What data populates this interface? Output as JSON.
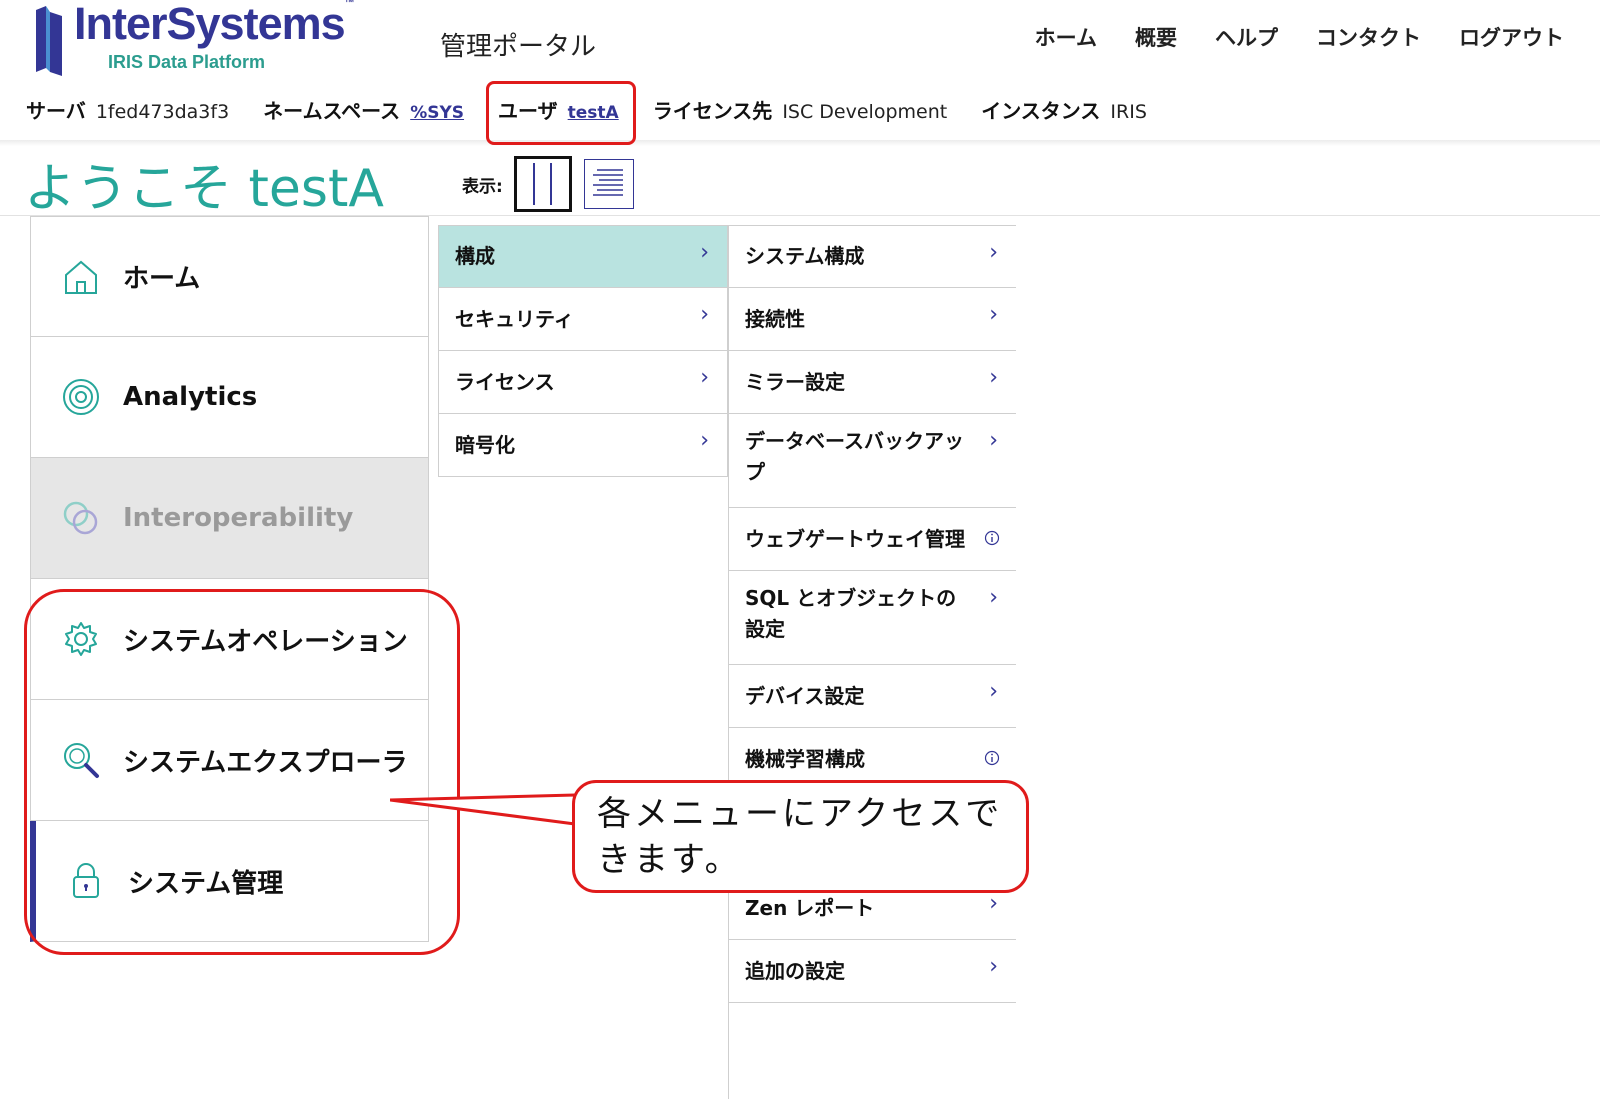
{
  "header": {
    "logo_name": "InterSystems",
    "logo_sub": "IRIS Data Platform",
    "portal_title": "管理ポータル",
    "nav": [
      "ホーム",
      "概要",
      "ヘルプ",
      "コンタクト",
      "ログアウト"
    ]
  },
  "infobar": {
    "server_label": "サーバ",
    "server_value": "1fed473da3f3",
    "namespace_label": "ネームスペース",
    "namespace_value": "%SYS",
    "user_label": "ユーザ",
    "user_value": "testA",
    "license_label": "ライセンス先",
    "license_value": "ISC Development",
    "instance_label": "インスタンス",
    "instance_value": "IRIS"
  },
  "welcome": "ようこそ testA",
  "view_label": "表示:",
  "leftnav": [
    {
      "label": "ホーム",
      "icon": "home-icon"
    },
    {
      "label": "Analytics",
      "icon": "analytics-icon"
    },
    {
      "label": "Interoperability",
      "icon": "interoperability-icon",
      "disabled": true
    },
    {
      "label": "システムオペレーション",
      "icon": "gear-icon"
    },
    {
      "label": "システムエクスプローラ",
      "icon": "search-icon"
    },
    {
      "label": "システム管理",
      "icon": "lock-icon",
      "active": true
    }
  ],
  "menu1": [
    "構成",
    "セキュリティ",
    "ライセンス",
    "暗号化"
  ],
  "menu2": [
    {
      "label": "システム構成",
      "marker": "›"
    },
    {
      "label": "接続性",
      "marker": "›"
    },
    {
      "label": "ミラー設定",
      "marker": "›"
    },
    {
      "label": "データベースバックアップ",
      "marker": "›"
    },
    {
      "label": "ウェブゲートウェイ管理",
      "marker": "info"
    },
    {
      "label": "SQL とオブジェクトの設定",
      "marker": "›"
    },
    {
      "label": "デバイス設定",
      "marker": "›"
    },
    {
      "label": "機械学習構成",
      "marker": "info"
    },
    {
      "label": "",
      "marker": "›"
    },
    {
      "label": "Zen レポート",
      "marker": "›"
    },
    {
      "label": "追加の設定",
      "marker": "›"
    }
  ],
  "chevron": "›",
  "callout": "各メニューにアクセスできます。",
  "colors": {
    "brand": "#333695",
    "teal": "#26a69a",
    "selected": "#b9e3e0",
    "annotation": "#e01b1b"
  }
}
